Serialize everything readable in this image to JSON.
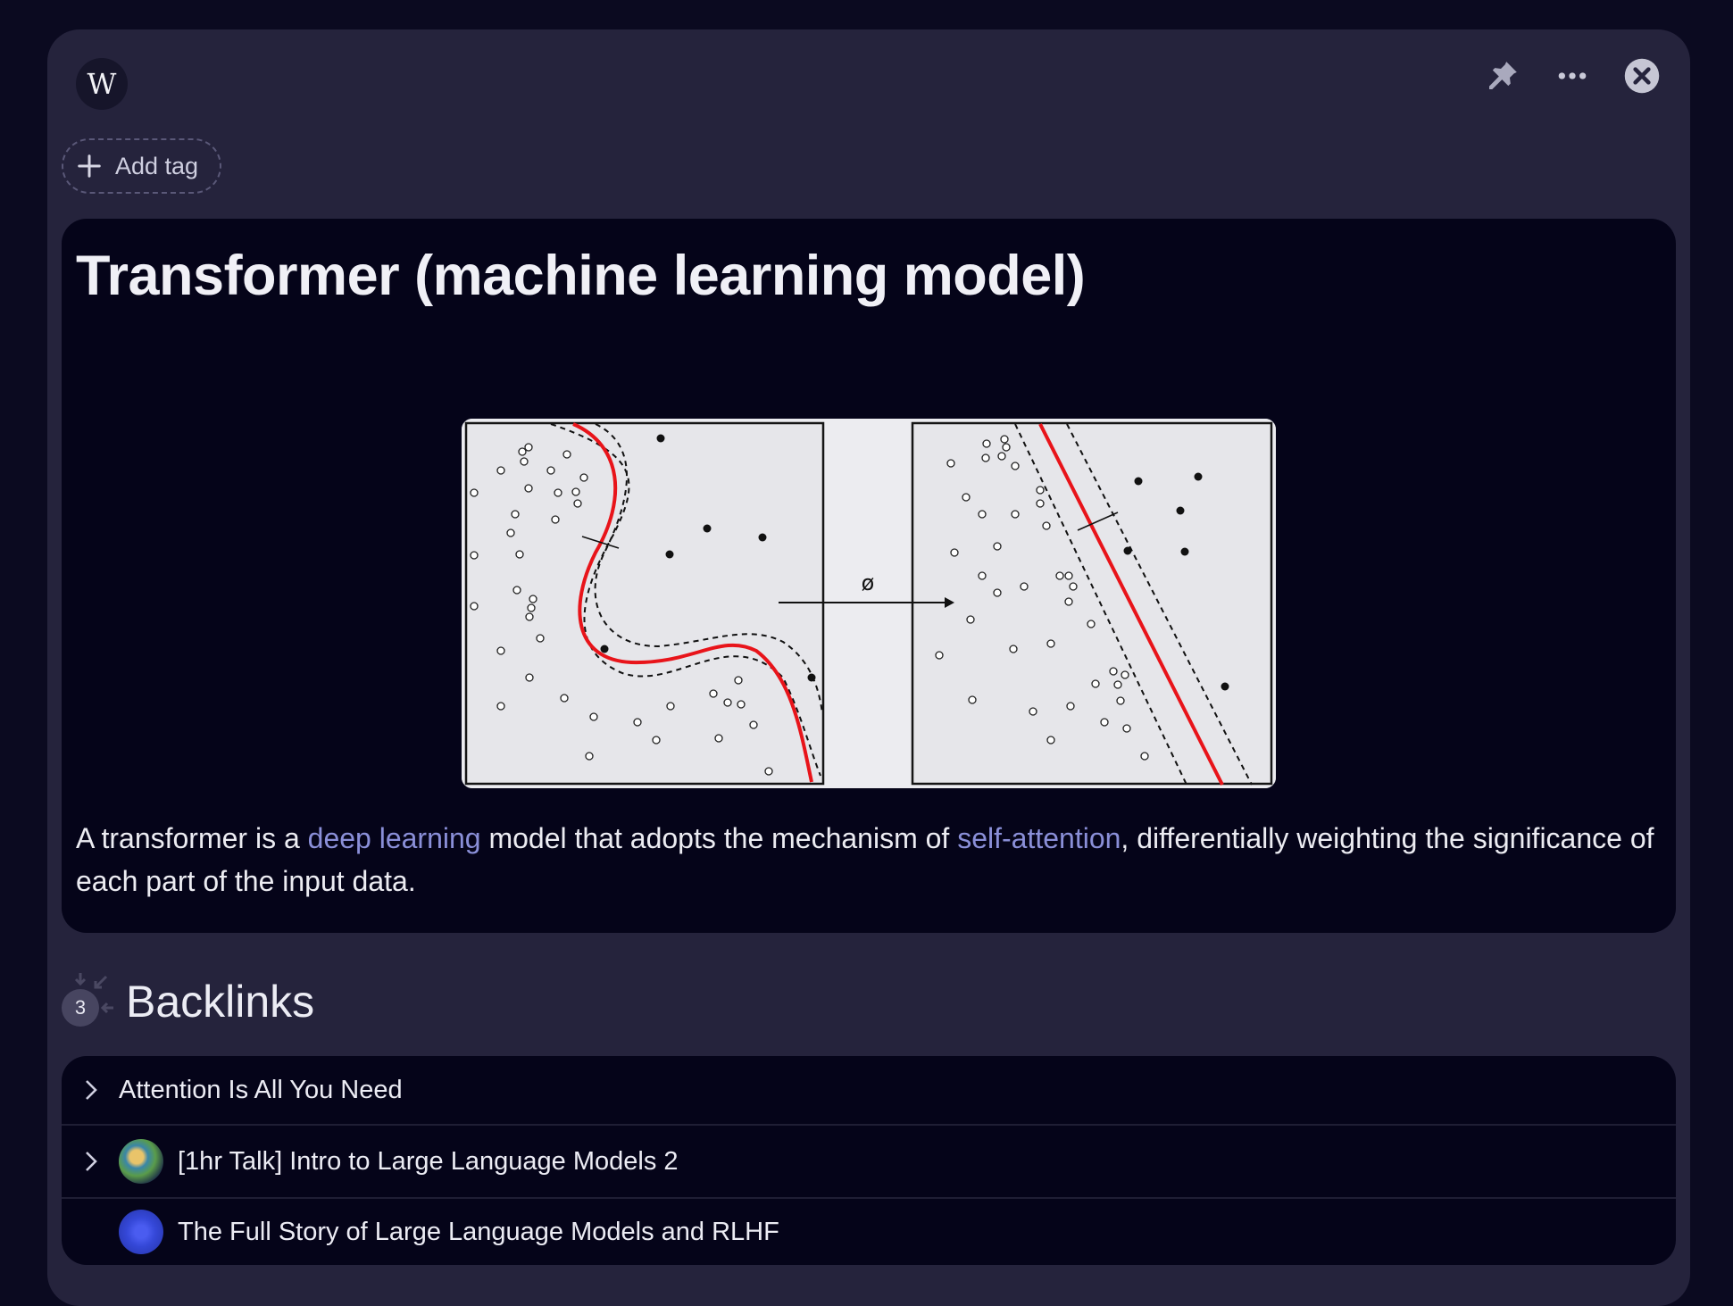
{
  "header": {
    "badge_letter": "W",
    "icons": [
      "pin-icon",
      "more-icon",
      "close-icon"
    ]
  },
  "tags": {
    "add_label": "Add tag"
  },
  "article": {
    "title": "Transformer (machine learning model)",
    "figure": {
      "arrow_label": "ø"
    },
    "summary": {
      "part1": "A transformer is a ",
      "link1": "deep learning",
      "part2": " model that adopts the mechanism of ",
      "link2": "self-attention",
      "part3": ", differentially weighting the significance of each part of the input data."
    }
  },
  "backlinks": {
    "count": "3",
    "heading": "Backlinks",
    "items": [
      {
        "title": "Attention Is All You Need"
      },
      {
        "title": "[1hr Talk] Intro to Large Language Models 2"
      },
      {
        "title": "The Full Story of Large Language Models and RLHF"
      }
    ]
  },
  "colors": {
    "background": "#0b0a20",
    "panel": "#25233c",
    "card": "#050419",
    "link": "#8a8fd8",
    "decision_boundary": "#e8141a"
  }
}
